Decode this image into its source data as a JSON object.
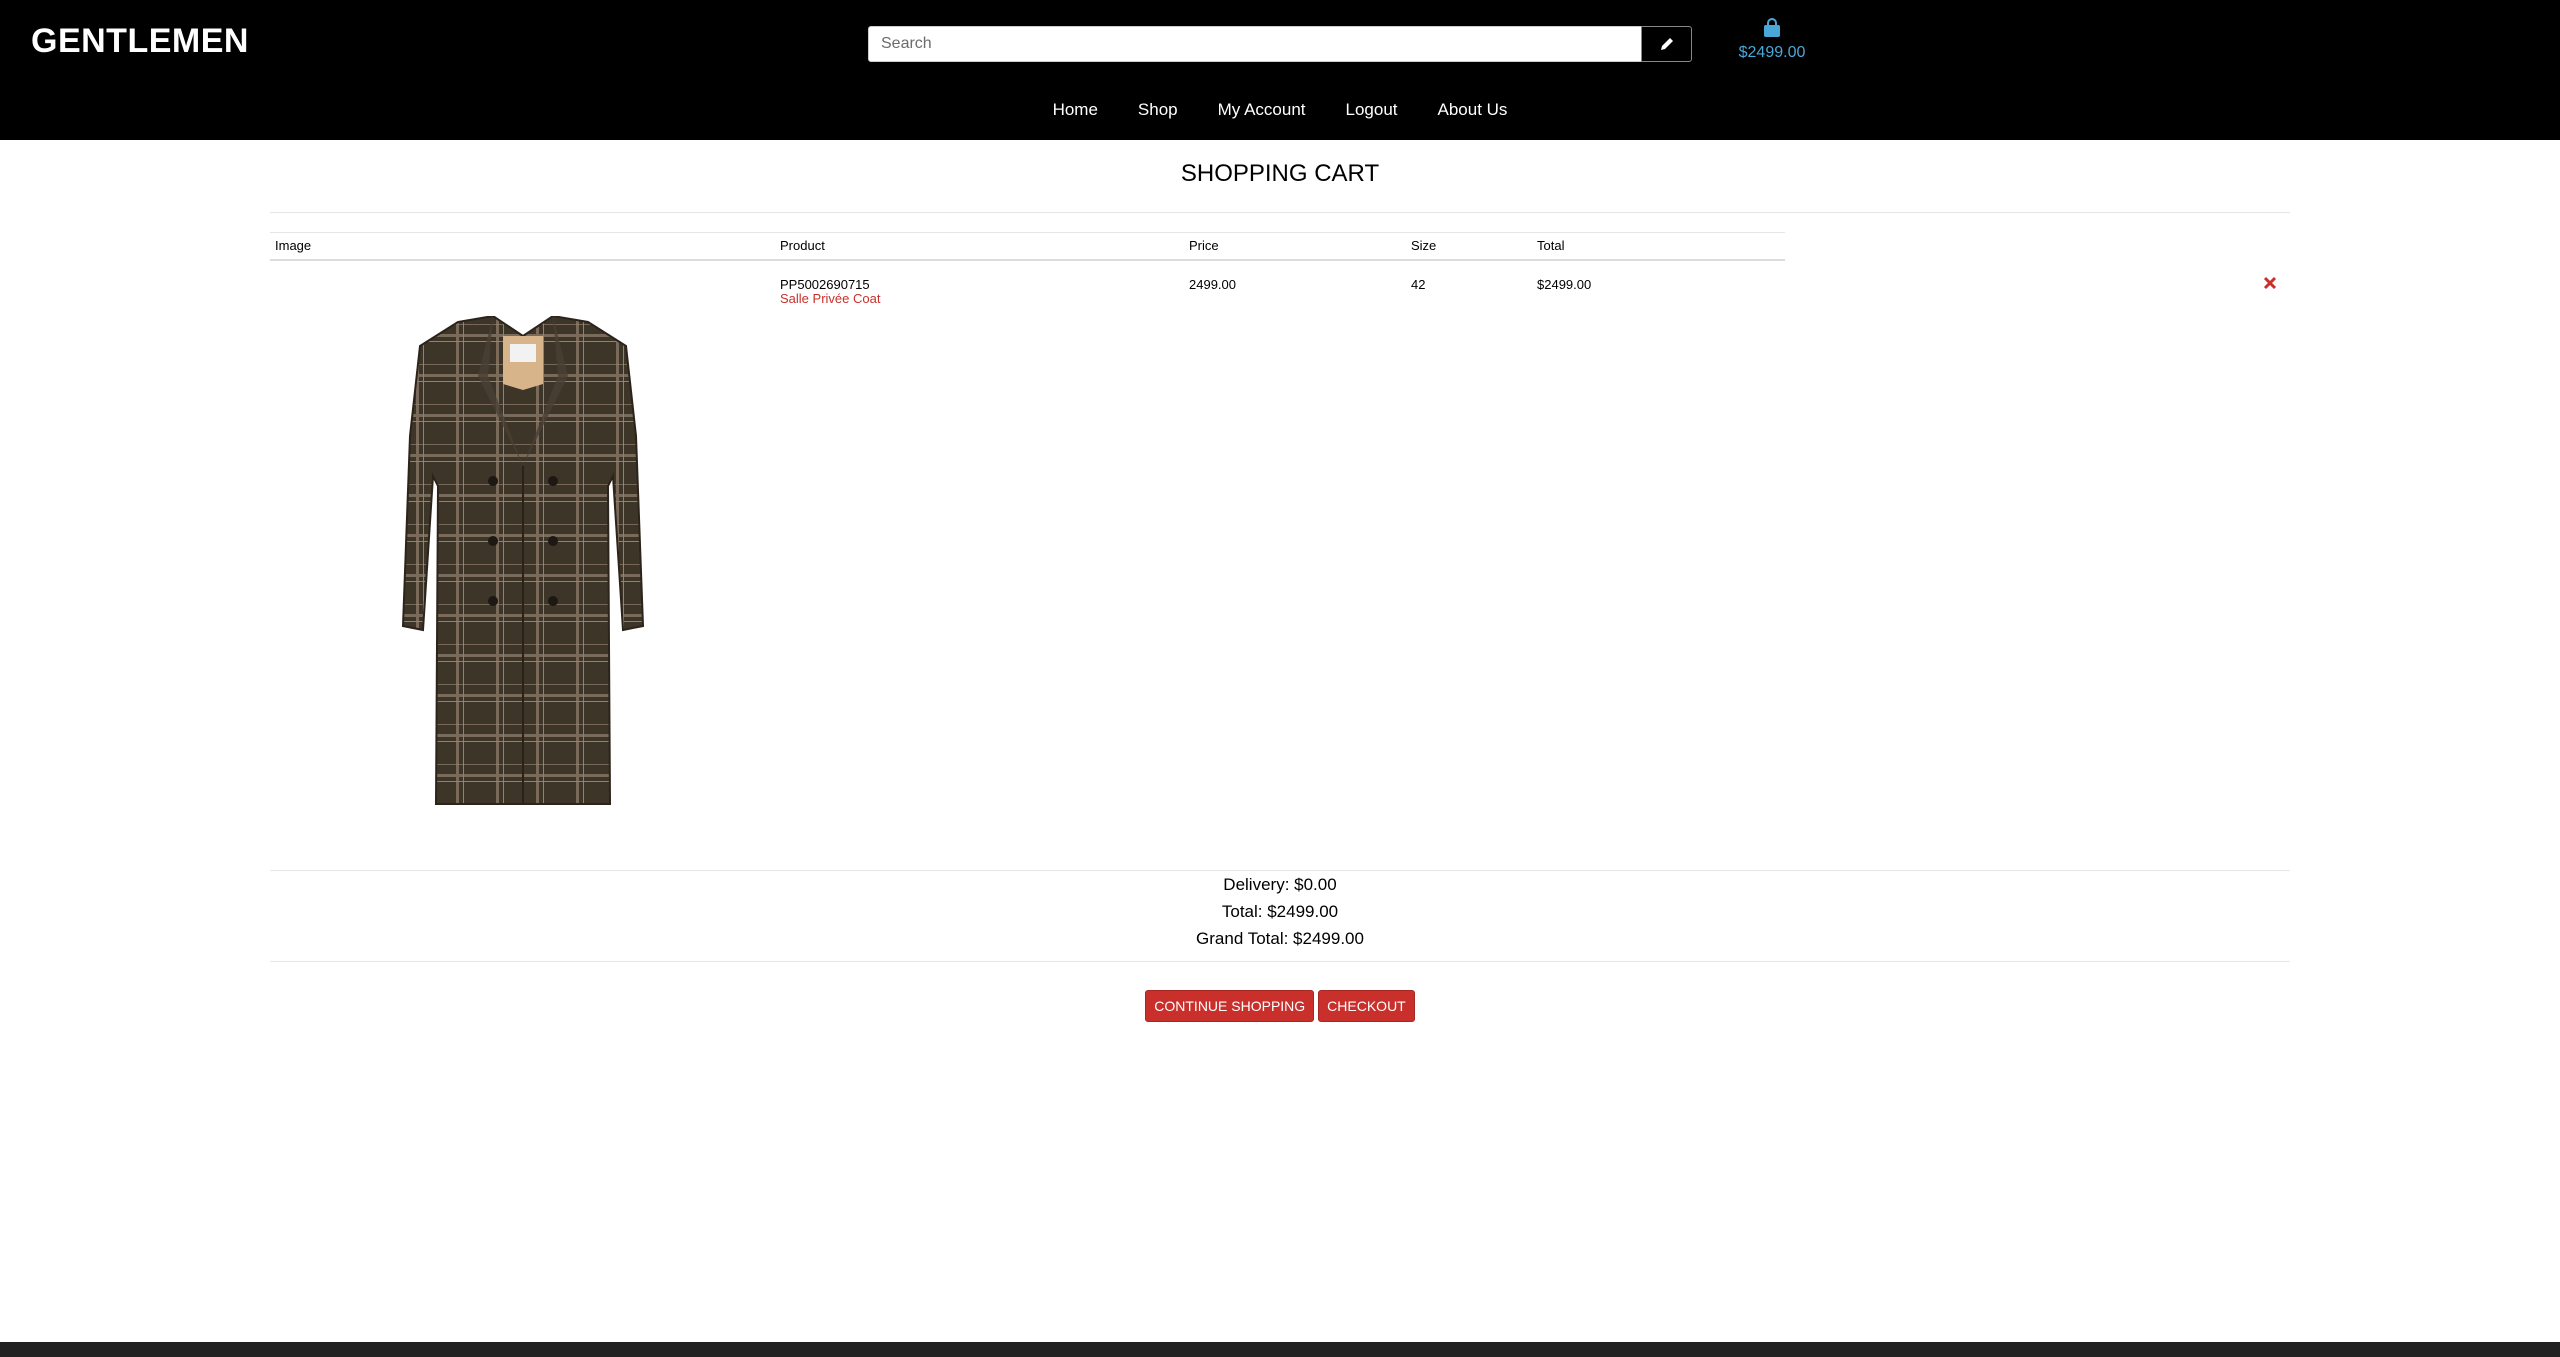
{
  "header": {
    "logo": "GENTLEMEN",
    "search_placeholder": "Search",
    "search_button_icon": "pencil-icon",
    "bag_icon": "shopping-bag-icon",
    "bag_total": "$2499.00"
  },
  "nav": [
    "Home",
    "Shop",
    "My Account",
    "Logout",
    "About Us"
  ],
  "page_title": "SHOPPING CART",
  "table": {
    "headers": [
      "Image",
      "Product",
      "Price",
      "Size",
      "Total"
    ],
    "rows": [
      {
        "sku": "PP5002690715",
        "name": "Salle Privée Coat",
        "price": "2499.00",
        "size": "42",
        "total": "$2499.00",
        "remove_icon": "close-icon"
      }
    ]
  },
  "summary": {
    "delivery": "Delivery: $0.00",
    "total": "Total: $2499.00",
    "grand_total": "Grand Total: $2499.00"
  },
  "buttons": {
    "continue": "CONTINUE SHOPPING",
    "checkout": "CHECKOUT"
  },
  "colors": {
    "accent_red": "#c9302c",
    "bag_blue": "#4aa8d8",
    "header_bg": "#000000"
  }
}
